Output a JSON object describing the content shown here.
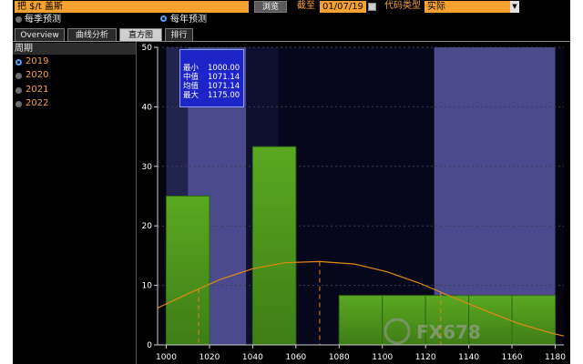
{
  "toolbar": {
    "command_value": "把 $/t 盖斯",
    "browse_label": "浏览",
    "date_label": "截至",
    "date_value": "01/07/19",
    "code_type_label": "代码类型",
    "code_type_value": "实际"
  },
  "mode": {
    "options": [
      {
        "label": "每季预测",
        "selected": false
      },
      {
        "label": "每年预测",
        "selected": true
      }
    ]
  },
  "tabs": [
    {
      "label": "Overview",
      "active": false
    },
    {
      "label": "曲线分析",
      "active": false
    },
    {
      "label": "直方图",
      "active": true
    },
    {
      "label": "排行",
      "active": false
    }
  ],
  "period_panel": {
    "header": "周期",
    "years": [
      {
        "label": "2019",
        "selected": true
      },
      {
        "label": "2020",
        "selected": false
      },
      {
        "label": "2021",
        "selected": false
      },
      {
        "label": "2022",
        "selected": false
      }
    ]
  },
  "stats": [
    {
      "label": "最小",
      "value": "1000.00"
    },
    {
      "label": "中值",
      "value": "1071.14"
    },
    {
      "label": "均值",
      "value": "1071.14"
    },
    {
      "label": "最大",
      "value": "1175.00"
    }
  ],
  "watermark": "FX678",
  "colors": {
    "accent_orange": "#f7a230",
    "bar_green": "#4e9a1c",
    "curve_orange": "#e08a17",
    "band_purple": "#3a3a7a",
    "stats_box": "#1d24c8"
  },
  "chart_data": {
    "type": "bar",
    "title": "",
    "xlabel": "",
    "ylabel": "",
    "xlim": [
      996,
      1184
    ],
    "ylim": [
      0,
      50
    ],
    "x_ticks": [
      1000,
      1020,
      1040,
      1060,
      1080,
      1100,
      1120,
      1140,
      1160,
      1180
    ],
    "y_ticks": [
      0,
      10,
      20,
      30,
      40,
      50
    ],
    "bars": [
      {
        "x0": 1000,
        "x1": 1020,
        "value": 25
      },
      {
        "x0": 1040,
        "x1": 1060,
        "value": 33.3
      },
      {
        "x0": 1080,
        "x1": 1100,
        "value": 8.3
      },
      {
        "x0": 1100,
        "x1": 1120,
        "value": 8.3
      },
      {
        "x0": 1120,
        "x1": 1140,
        "value": 8.3
      },
      {
        "x0": 1140,
        "x1": 1160,
        "value": 8.3
      },
      {
        "x0": 1160,
        "x1": 1180,
        "value": 8.3
      }
    ],
    "curve": [
      {
        "x": 996,
        "y": 6.2
      },
      {
        "x": 1010,
        "y": 8.6
      },
      {
        "x": 1025,
        "y": 11.0
      },
      {
        "x": 1040,
        "y": 12.8
      },
      {
        "x": 1055,
        "y": 13.8
      },
      {
        "x": 1071,
        "y": 14.0
      },
      {
        "x": 1087,
        "y": 13.6
      },
      {
        "x": 1102,
        "y": 12.3
      },
      {
        "x": 1117,
        "y": 10.4
      },
      {
        "x": 1132,
        "y": 8.1
      },
      {
        "x": 1148,
        "y": 5.7
      },
      {
        "x": 1163,
        "y": 3.6
      },
      {
        "x": 1178,
        "y": 2.0
      },
      {
        "x": 1184,
        "y": 1.5
      }
    ],
    "dashed_markers": [
      1015,
      1071,
      1127
    ],
    "shaded_bands": [
      {
        "x0": 1000,
        "x1": 1010,
        "shade": "mid"
      },
      {
        "x0": 1010,
        "x1": 1037,
        "shade": "light"
      },
      {
        "x0": 1037,
        "x1": 1052,
        "shade": "dark"
      },
      {
        "x0": 1052,
        "x1": 1124,
        "shade": "darkest"
      },
      {
        "x0": 1124,
        "x1": 1180,
        "shade": "light"
      }
    ],
    "grid": true,
    "legend": "none"
  }
}
